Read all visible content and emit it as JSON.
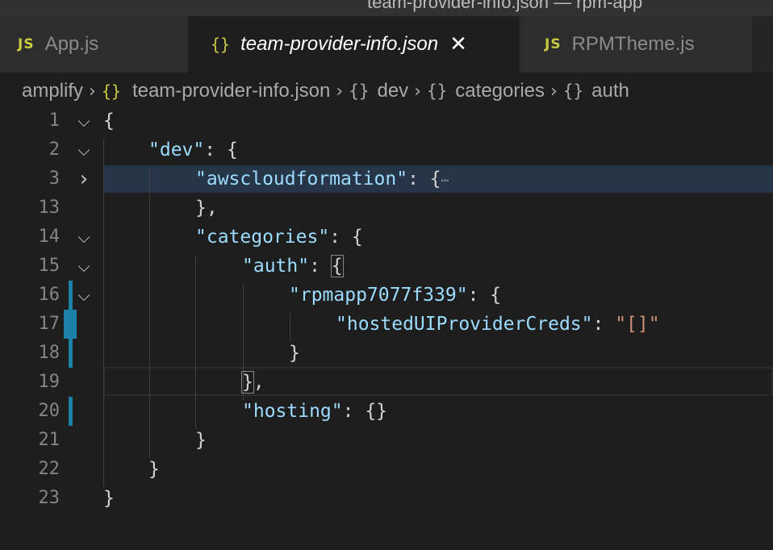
{
  "window": {
    "title": "team-provider-info.json — rpm-app"
  },
  "tabs": [
    {
      "icon": "js-file-icon",
      "icon_text": "JS",
      "label": "App.js",
      "active": false
    },
    {
      "icon": "json-file-icon",
      "icon_text": "{}",
      "label": "team-provider-info.json",
      "active": true,
      "close": "✕"
    },
    {
      "icon": "js-file-icon",
      "icon_text": "JS",
      "label": "RPMTheme.js",
      "active": false
    }
  ],
  "breadcrumb": {
    "separator": "›",
    "items": [
      {
        "label": "amplify"
      },
      {
        "icon_text": "{}",
        "label": "team-provider-info.json"
      },
      {
        "icon_text": "{}",
        "label": "dev"
      },
      {
        "icon_text": "{}",
        "label": "categories"
      },
      {
        "icon_text": "{}",
        "label": "auth"
      }
    ]
  },
  "editor": {
    "fold_open": "⌵",
    "fold_closed": "›",
    "lines": [
      {
        "num": "1"
      },
      {
        "num": "2"
      },
      {
        "num": "3"
      },
      {
        "num": "13"
      },
      {
        "num": "14"
      },
      {
        "num": "15"
      },
      {
        "num": "16"
      },
      {
        "num": "17"
      },
      {
        "num": "18"
      },
      {
        "num": "19"
      },
      {
        "num": "20"
      },
      {
        "num": "21"
      },
      {
        "num": "22"
      },
      {
        "num": "23"
      }
    ],
    "tokens": {
      "open_brace": "{",
      "close_brace": "}",
      "close_brace_comma": "},",
      "colon_brace": ": {",
      "colon_space": ": ",
      "colon_empty": ": {}",
      "comma": ",",
      "dev": "\"dev\"",
      "awscloudformation": "\"awscloudformation\"",
      "ellipsis": "⋯",
      "categories": "\"categories\"",
      "auth": "\"auth\"",
      "rpmapp": "\"rpmapp7077f339\"",
      "hostedUI": "\"hostedUIProviderCreds\"",
      "hostedUI_value": "\"[]\"",
      "hosting": "\"hosting\""
    }
  },
  "colors": {
    "background": "#1e1e1e",
    "key": "#9cdcfe",
    "string": "#ce9178",
    "punctuation": "#d4d4d4",
    "line_number": "#858585",
    "js_icon": "#cbcb41",
    "modified_gutter": "#1b81a8",
    "line_highlight": "#263548"
  }
}
